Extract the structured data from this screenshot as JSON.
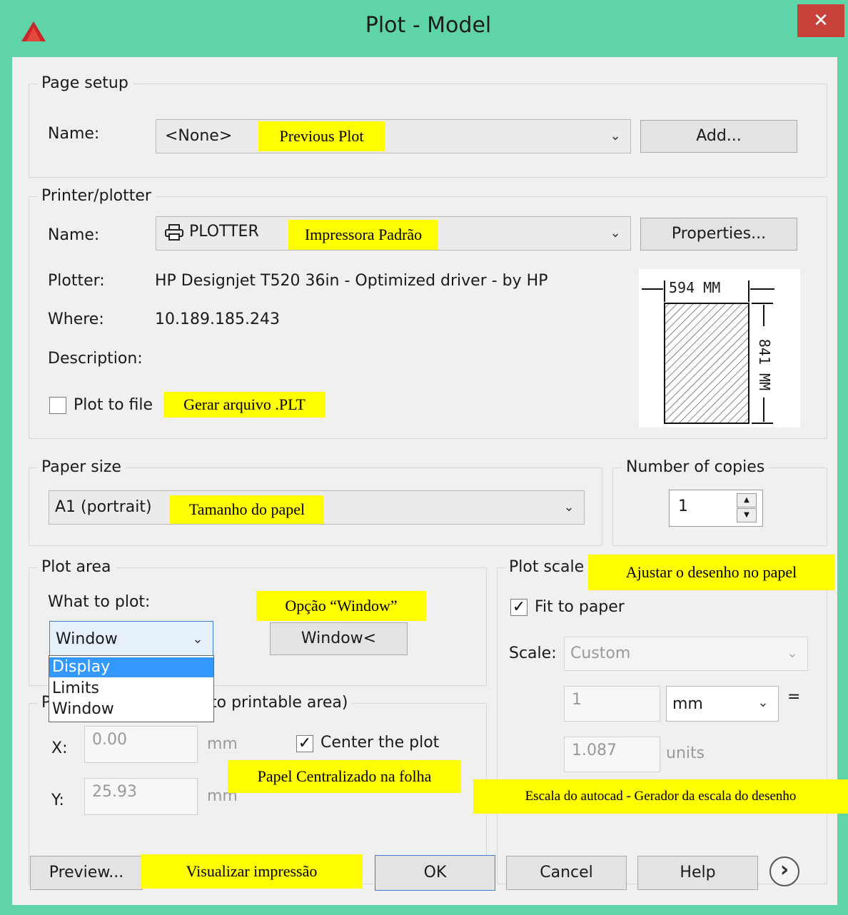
{
  "window": {
    "title": "Plot - Model",
    "close_glyph": "✕",
    "accent": "#5fd4a8"
  },
  "page_setup": {
    "group": "Page setup",
    "name_label": "Name:",
    "name_value": "<None>",
    "add_button": "Add..."
  },
  "printer": {
    "group": "Printer/plotter",
    "name_label": "Name:",
    "name_value": "PLOTTER",
    "properties_button": "Properties...",
    "plotter_label": "Plotter:",
    "plotter_value": "HP Designjet T520 36in - Optimized driver - by HP",
    "where_label": "Where:",
    "where_value": "10.189.185.243",
    "description_label": "Description:",
    "plot_to_file": "Plot to file",
    "preview_width": "594 MM",
    "preview_height": "841 MM"
  },
  "paper_size": {
    "group": "Paper size",
    "value": "A1 (portrait)"
  },
  "copies": {
    "group": "Number of copies",
    "value": "1"
  },
  "plot_area": {
    "group": "Plot area",
    "what_label": "What to plot:",
    "selected": "Window",
    "options": [
      "Display",
      "Limits",
      "Window"
    ],
    "window_button": "Window<"
  },
  "plot_offset": {
    "group_prefix": "P",
    "group_tail": "to printable area)",
    "x_label": "X:",
    "x_value": "0.00",
    "y_label": "Y:",
    "y_value": "25.93",
    "unit": "mm",
    "center": "Center the plot",
    "check": "✓"
  },
  "plot_scale": {
    "group": "Plot scale",
    "fit": "Fit to paper",
    "scale_label": "Scale:",
    "scale_value": "Custom",
    "val1": "1",
    "unit1": "mm",
    "equals": "=",
    "val2": "1.087",
    "unit2": "units"
  },
  "buttons": {
    "preview": "Preview...",
    "ok": "OK",
    "cancel": "Cancel",
    "help": "Help",
    "expand": "›"
  },
  "annotations": {
    "previous_plot": "Previous Plot",
    "impressora": "Impressora Padrão",
    "gerar": "Gerar arquivo .PLT",
    "tamanho": "Tamanho do papel",
    "ajustar": "Ajustar o desenho no papel",
    "opcao": "Opção “Window”",
    "centralizado": "Papel Centralizado na folha",
    "escala": "Escala do autocad - Gerador da escala do desenho",
    "visualizar": "Visualizar impressão"
  }
}
